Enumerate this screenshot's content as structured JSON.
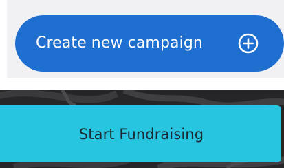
{
  "create_campaign": {
    "label": "Create new campaign",
    "icon": "plus-circle-icon",
    "color": "#1f6fd0"
  },
  "start_fundraising": {
    "label": "Start Fundraising",
    "color": "#27c5e0"
  }
}
